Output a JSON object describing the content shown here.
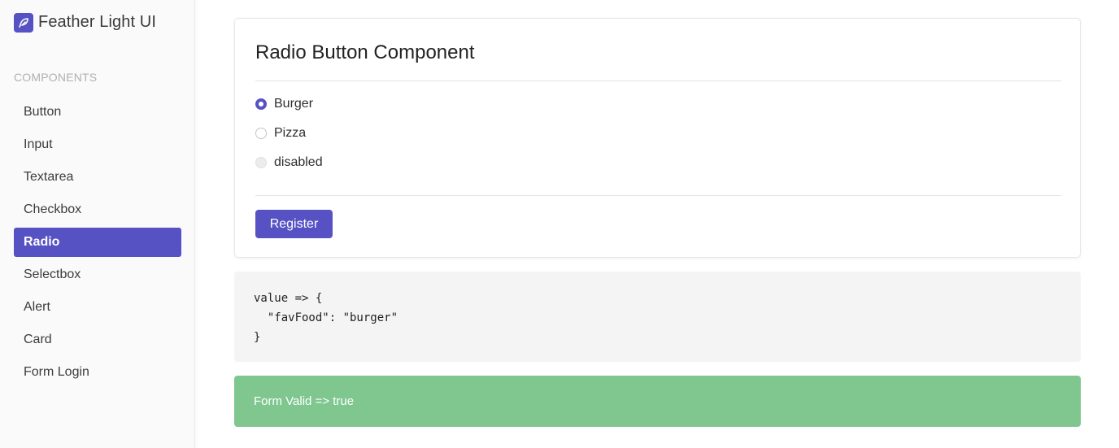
{
  "brand": {
    "title": "Feather Light UI",
    "icon": "feather-icon",
    "color": "#5752c4"
  },
  "sidebar": {
    "section_label": "COMPONENTS",
    "items": [
      {
        "label": "Button",
        "active": false
      },
      {
        "label": "Input",
        "active": false
      },
      {
        "label": "Textarea",
        "active": false
      },
      {
        "label": "Checkbox",
        "active": false
      },
      {
        "label": "Radio",
        "active": true
      },
      {
        "label": "Selectbox",
        "active": false
      },
      {
        "label": "Alert",
        "active": false
      },
      {
        "label": "Card",
        "active": false
      },
      {
        "label": "Form Login",
        "active": false
      }
    ]
  },
  "card": {
    "title": "Radio Button Component",
    "options": [
      {
        "label": "Burger",
        "checked": true,
        "disabled": false
      },
      {
        "label": "Pizza",
        "checked": false,
        "disabled": false
      },
      {
        "label": "disabled",
        "checked": false,
        "disabled": true
      }
    ],
    "submit_label": "Register"
  },
  "code": {
    "text": "value => {\n  \"favFood\": \"burger\"\n}"
  },
  "alert": {
    "text": "Form Valid => true",
    "color": "#7fc78f"
  }
}
